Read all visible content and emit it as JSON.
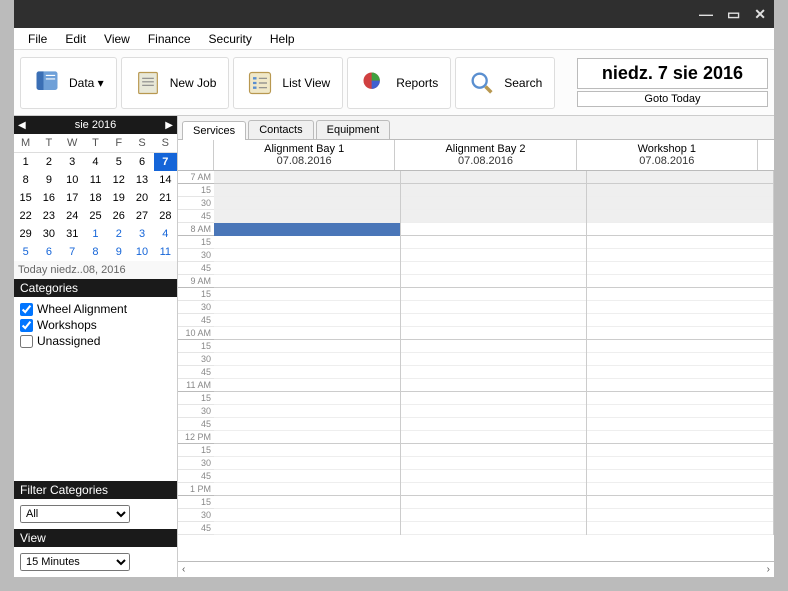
{
  "menus": {
    "file": "File",
    "edit": "Edit",
    "view": "View",
    "finance": "Finance",
    "security": "Security",
    "help": "Help"
  },
  "toolbar": {
    "data": "Data ▾",
    "newjob": "New Job",
    "listview": "List View",
    "reports": "Reports",
    "search": "Search"
  },
  "date_display": "niedz. 7 sie 2016",
  "goto_today": "Goto Today",
  "calendar": {
    "month_label": "sie 2016",
    "dow": [
      "M",
      "T",
      "W",
      "T",
      "F",
      "S",
      "S"
    ],
    "weeks": [
      [
        {
          "d": 1
        },
        {
          "d": 2
        },
        {
          "d": 3
        },
        {
          "d": 4
        },
        {
          "d": 5
        },
        {
          "d": 6
        },
        {
          "d": 7,
          "sel": true
        }
      ],
      [
        {
          "d": 8
        },
        {
          "d": 9
        },
        {
          "d": 10
        },
        {
          "d": 11
        },
        {
          "d": 12
        },
        {
          "d": 13
        },
        {
          "d": 14
        }
      ],
      [
        {
          "d": 15
        },
        {
          "d": 16
        },
        {
          "d": 17
        },
        {
          "d": 18
        },
        {
          "d": 19
        },
        {
          "d": 20
        },
        {
          "d": 21
        }
      ],
      [
        {
          "d": 22
        },
        {
          "d": 23
        },
        {
          "d": 24
        },
        {
          "d": 25
        },
        {
          "d": 26
        },
        {
          "d": 27
        },
        {
          "d": 28
        }
      ],
      [
        {
          "d": 29
        },
        {
          "d": 30
        },
        {
          "d": 31
        },
        {
          "d": 1,
          "o": true
        },
        {
          "d": 2,
          "o": true
        },
        {
          "d": 3,
          "o": true
        },
        {
          "d": 4,
          "o": true
        }
      ],
      [
        {
          "d": 5,
          "o": true
        },
        {
          "d": 6,
          "o": true
        },
        {
          "d": 7,
          "o": true
        },
        {
          "d": 8,
          "o": true
        },
        {
          "d": 9,
          "o": true
        },
        {
          "d": 10,
          "o": true
        },
        {
          "d": 11,
          "o": true
        }
      ]
    ],
    "today_line": "Today niedz..08, 2016"
  },
  "categories_title": "Categories",
  "categories": [
    {
      "label": "Wheel Alignment",
      "checked": true
    },
    {
      "label": "Workshops",
      "checked": true
    },
    {
      "label": "Unassigned",
      "checked": false
    }
  ],
  "filter_title": "Filter Categories",
  "filter_value": "All",
  "view_title": "View",
  "view_value": "15 Minutes",
  "tabs": {
    "services": "Services",
    "contacts": "Contacts",
    "equipment": "Equipment"
  },
  "resources": [
    {
      "name": "Alignment Bay 1",
      "date": "07.08.2016"
    },
    {
      "name": "Alignment Bay 2",
      "date": "07.08.2016"
    },
    {
      "name": "Workshop 1",
      "date": "07.08.2016"
    }
  ],
  "time_slots": [
    {
      "h": "7 AM",
      "sub": [
        "15",
        "30",
        "45"
      ],
      "early": true
    },
    {
      "h": "8 AM",
      "sub": [
        "15",
        "30",
        "45"
      ],
      "apt_col": 0
    },
    {
      "h": "9 AM",
      "sub": [
        "15",
        "30",
        "45"
      ]
    },
    {
      "h": "10 AM",
      "sub": [
        "15",
        "30",
        "45"
      ]
    },
    {
      "h": "11 AM",
      "sub": [
        "15",
        "30",
        "45"
      ]
    },
    {
      "h": "12 PM",
      "sub": [
        "15",
        "30",
        "45"
      ]
    },
    {
      "h": "1 PM",
      "sub": [
        "15",
        "30",
        "45"
      ]
    }
  ]
}
